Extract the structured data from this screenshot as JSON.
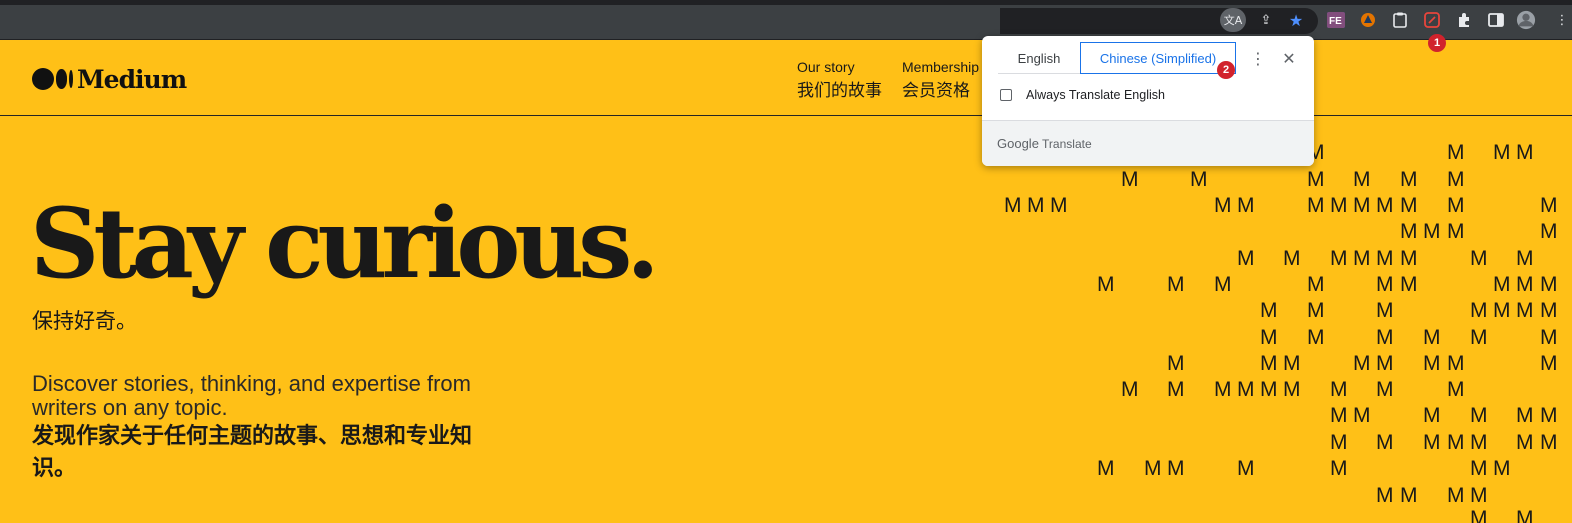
{
  "browser": {
    "extension_badge": "1"
  },
  "site": {
    "logo_text": "Medium",
    "nav": [
      {
        "en": "Our story",
        "zh": "我们的故事"
      },
      {
        "en": "Membership",
        "zh": "会员资格"
      }
    ]
  },
  "hero": {
    "title": "Stay curious.",
    "title_zh": "保持好奇。",
    "subtitle": "Discover stories, thinking, and expertise from writers on any topic.",
    "subtitle_zh": "发现作家关于任何主题的故事、思想和专业知识。"
  },
  "translate_popup": {
    "tab_source": "English",
    "tab_target": "Chinese (Simplified)",
    "tab_badge": "2",
    "always_translate_label": "Always Translate English",
    "always_translate_checked": false,
    "brand_google": "Google",
    "brand_product": "Translate"
  },
  "decor": {
    "letter": "M"
  },
  "colors": {
    "background": "#ffc017",
    "toolbar": "#3c4043",
    "accent_blue": "#1a73e8",
    "badge_red": "#d1222c"
  }
}
